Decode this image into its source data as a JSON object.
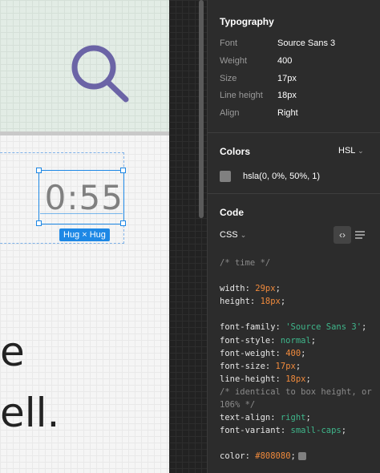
{
  "canvas": {
    "time_text": "0:55",
    "hug_badge": "Hug × Hug",
    "big_text_line1": "e",
    "big_text_line2": "ell."
  },
  "panel": {
    "typography": {
      "title": "Typography",
      "rows": [
        {
          "label": "Font",
          "value": "Source Sans 3"
        },
        {
          "label": "Weight",
          "value": "400"
        },
        {
          "label": "Size",
          "value": "17px"
        },
        {
          "label": "Line height",
          "value": "18px"
        },
        {
          "label": "Align",
          "value": "Right"
        }
      ]
    },
    "colors": {
      "title": "Colors",
      "mode": "HSL",
      "value": "hsla(0, 0%, 50%, 1)",
      "swatch": "#808080"
    },
    "code": {
      "title": "Code",
      "language": "CSS",
      "comment_time": "/* time */",
      "width_prop": "width: ",
      "width_val": "29px",
      "height_prop": "height: ",
      "height_val": "18px",
      "ff_prop": "font-family: ",
      "ff_val": "'Source Sans 3'",
      "fs_prop": "font-style: ",
      "fs_val": "normal",
      "fw_prop": "font-weight: ",
      "fw_val": "400",
      "fz_prop": "font-size: ",
      "fz_val": "17px",
      "lh_prop": "line-height: ",
      "lh_val": "18px",
      "comment_identical_1": "/* identical to box height, or",
      "comment_identical_2": "106% */",
      "ta_prop": "text-align: ",
      "ta_val": "right",
      "fv_prop": "font-variant: ",
      "fv_val": "small-caps",
      "color_prop": "color: ",
      "color_val": "#808080",
      "semicolon": ";"
    }
  },
  "colors": {
    "accent": "#1e88e5",
    "panel_bg": "#2c2c2c",
    "icon_purple": "#6b64a6"
  }
}
